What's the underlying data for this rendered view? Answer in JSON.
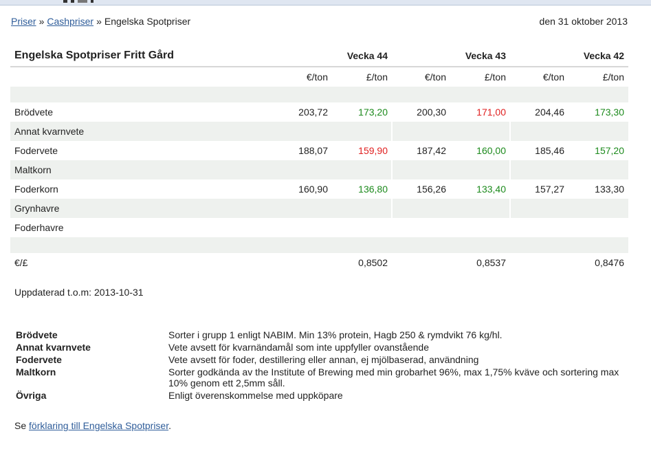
{
  "breadcrumb": {
    "items": [
      "Priser",
      "Cashpriser"
    ],
    "separator": "»",
    "current": "Engelska Spotpriser"
  },
  "date": "den 31 oktober 2013",
  "table": {
    "title": "Engelska Spotpriser Fritt Gård",
    "weeks": [
      "Vecka 44",
      "Vecka 43",
      "Vecka 42"
    ],
    "units": [
      "€/ton",
      "£/ton",
      "€/ton",
      "£/ton",
      "€/ton",
      "£/ton"
    ],
    "rows": [
      {
        "name": "Brödvete",
        "values": [
          "203,72",
          "173,20",
          "200,30",
          "171,00",
          "204,46",
          "173,30"
        ],
        "colors": [
          "black",
          "green",
          "black",
          "red",
          "black",
          "green"
        ]
      },
      {
        "name": "Annat kvarnvete",
        "values": [
          "",
          "",
          "",
          "",
          "",
          ""
        ],
        "colors": [
          "black",
          "black",
          "black",
          "black",
          "black",
          "black"
        ]
      },
      {
        "name": "Fodervete",
        "values": [
          "188,07",
          "159,90",
          "187,42",
          "160,00",
          "185,46",
          "157,20"
        ],
        "colors": [
          "black",
          "red",
          "black",
          "green",
          "black",
          "green"
        ]
      },
      {
        "name": "Maltkorn",
        "values": [
          "",
          "",
          "",
          "",
          "",
          ""
        ],
        "colors": [
          "black",
          "black",
          "black",
          "black",
          "black",
          "black"
        ]
      },
      {
        "name": "Foderkorn",
        "values": [
          "160,90",
          "136,80",
          "156,26",
          "133,40",
          "157,27",
          "133,30"
        ],
        "colors": [
          "black",
          "green",
          "black",
          "green",
          "black",
          "black"
        ]
      },
      {
        "name": "Grynhavre",
        "values": [
          "",
          "",
          "",
          "",
          "",
          ""
        ],
        "colors": [
          "black",
          "black",
          "black",
          "black",
          "black",
          "black"
        ]
      },
      {
        "name": "Foderhavre",
        "values": [
          "",
          "",
          "",
          "",
          "",
          ""
        ],
        "colors": [
          "black",
          "black",
          "black",
          "black",
          "black",
          "black"
        ]
      }
    ],
    "fx": {
      "label": "€/£",
      "values": [
        "0,8502",
        "0,8537",
        "0,8476"
      ]
    }
  },
  "updated": "Uppdaterad t.o.m: 2013-10-31",
  "definitions": [
    {
      "term": "Brödvete",
      "desc": "Sorter i grupp 1 enligt NABIM. Min 13% protein, Hagb 250 & rymdvikt 76 kg/hl."
    },
    {
      "term": "Annat kvarnvete",
      "desc": "Vete avsett för kvarnändamål som inte uppfyller ovanstående"
    },
    {
      "term": "Fodervete",
      "desc": "Vete avsett för foder, destillering eller annan, ej mjölbaserad, användning"
    },
    {
      "term": "Maltkorn",
      "desc": "Sorter godkända av the Institute of Brewing med min grobarhet 96%, max 1,75% kväve och sortering max 10% genom ett 2,5mm såll."
    },
    {
      "term": "Övriga",
      "desc": "Enligt överenskommelse med uppköpare"
    }
  ],
  "see_also": {
    "prefix": "Se ",
    "link": "förklaring till Engelska Spotpriser",
    "suffix": "."
  },
  "colors": {
    "link": "#2e5c99",
    "green": "#1c8a1c",
    "red": "#e01f1f",
    "shade": "#eef1ee"
  }
}
